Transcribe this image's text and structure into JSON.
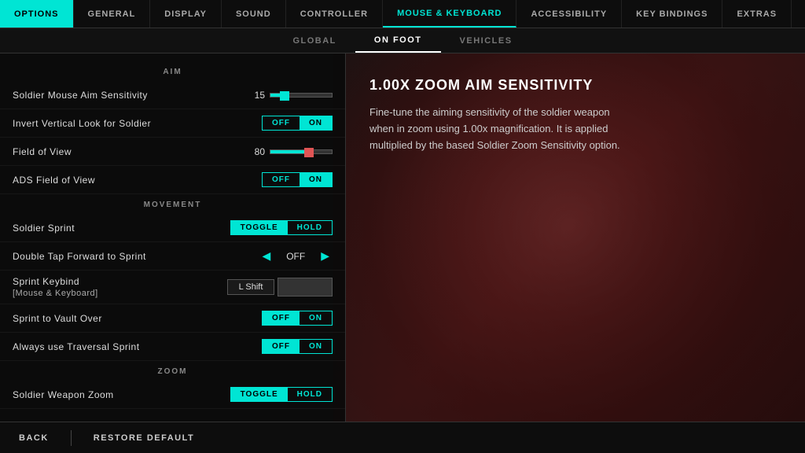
{
  "topNav": {
    "items": [
      {
        "label": "Options",
        "active": true
      },
      {
        "label": "General",
        "active": false
      },
      {
        "label": "Display",
        "active": false
      },
      {
        "label": "Sound",
        "active": false
      },
      {
        "label": "Controller",
        "active": false
      },
      {
        "label": "Mouse & Keyboard",
        "active": false,
        "selected": true
      },
      {
        "label": "Accessibility",
        "active": false
      },
      {
        "label": "Key Bindings",
        "active": false
      },
      {
        "label": "Extras",
        "active": false
      }
    ]
  },
  "subNav": {
    "items": [
      {
        "label": "Global",
        "active": false
      },
      {
        "label": "On Foot",
        "active": true
      },
      {
        "label": "Vehicles",
        "active": false
      }
    ]
  },
  "sections": [
    {
      "header": "Aim",
      "settings": [
        {
          "label": "Soldier Mouse Aim Sensitivity",
          "type": "slider",
          "value": "15",
          "fillPercent": 15
        },
        {
          "label": "Invert Vertical Look for Soldier",
          "type": "toggle-off-on",
          "selected": "on"
        },
        {
          "label": "Field of View",
          "type": "slider-simple",
          "value": "80",
          "fillPercent": 55
        },
        {
          "label": "ADS Field of View",
          "type": "toggle-off-on",
          "selected": "on"
        }
      ]
    },
    {
      "header": "Movement",
      "settings": [
        {
          "label": "Soldier Sprint",
          "type": "toggle-toggle-hold",
          "selected": "toggle"
        },
        {
          "label": "Double Tap Forward to Sprint",
          "type": "arrow-toggle",
          "value": "OFF"
        },
        {
          "label": "Sprint Keybind\n[Mouse & Keyboard]",
          "type": "keybind",
          "key": "L Shift"
        },
        {
          "label": "Sprint to Vault Over",
          "type": "toggle-off-on",
          "selected": "off"
        },
        {
          "label": "Always use Traversal Sprint",
          "type": "toggle-off-on",
          "selected": "off"
        }
      ]
    },
    {
      "header": "Zoom",
      "settings": [
        {
          "label": "Soldier Weapon Zoom",
          "type": "toggle-toggle-hold",
          "selected": "toggle"
        }
      ]
    }
  ],
  "infoPanel": {
    "title": "1.00x Zoom Aim Sensitivity",
    "description": "Fine-tune the aiming sensitivity of the soldier weapon when in zoom using 1.00x magnification. It is applied multiplied by the based Soldier Zoom Sensitivity option."
  },
  "bottomBar": {
    "backLabel": "Back",
    "restoreLabel": "Restore Default"
  }
}
